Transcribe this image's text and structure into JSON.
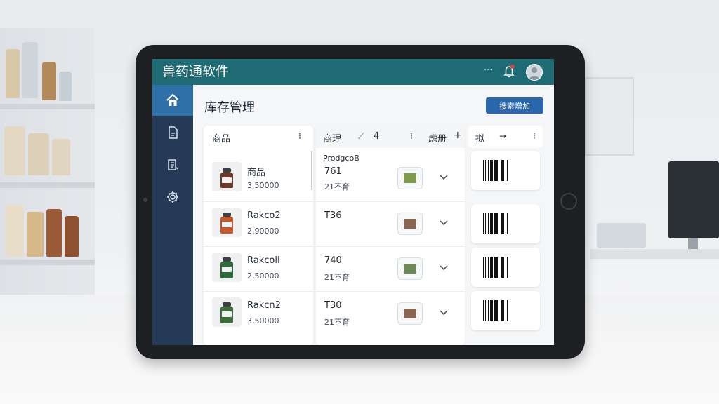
{
  "app": {
    "title": "兽药通软件",
    "notification_count": "1",
    "more_label": "···"
  },
  "sidebar": {
    "items": [
      {
        "icon": "home-icon",
        "active": true
      },
      {
        "icon": "document-icon",
        "active": false
      },
      {
        "icon": "list-icon",
        "active": false
      },
      {
        "icon": "gear-icon",
        "active": false
      }
    ]
  },
  "page": {
    "title": "库存管理",
    "primary_button_label": "搜索增加"
  },
  "table": {
    "product_col_header": "商品",
    "product_col_menu": "⁝",
    "mid_col_header": "商理",
    "mid_col_count": "4",
    "mid_col_menu": "⁝",
    "mid_col_header2": "虑册",
    "mid_col_add": "+",
    "mid_col_subheader": "ProdgcoB",
    "right_col_header": "拟",
    "right_col_arrow": "→",
    "right_col_menu": "⁝",
    "rows": [
      {
        "name": "商品",
        "qty": "3,50000",
        "code": "761",
        "sub": "21不育",
        "jar_color": "#6b3a28",
        "mini_color": "#7f9a4a"
      },
      {
        "name": "Rakco2",
        "qty": "2,90000",
        "code": "T36",
        "sub": "",
        "jar_color": "#c4582c",
        "mini_color": "#8a6650"
      },
      {
        "name": "Rakcoll",
        "qty": "2,50000",
        "code": "740",
        "sub": "21不育",
        "jar_color": "#2e6b3a",
        "mini_color": "#6c8a58"
      },
      {
        "name": "Rakcn2",
        "qty": "3,50000",
        "code": "T30",
        "sub": "21不育",
        "jar_color": "#3d6e3c",
        "mini_color": "#8a6650"
      }
    ]
  },
  "colors": {
    "topbar": "#1f6b73",
    "sidebar": "#243a57",
    "sidebar_active": "#2f6fa8",
    "primary_button": "#2a67ad",
    "badge": "#d8453b"
  }
}
